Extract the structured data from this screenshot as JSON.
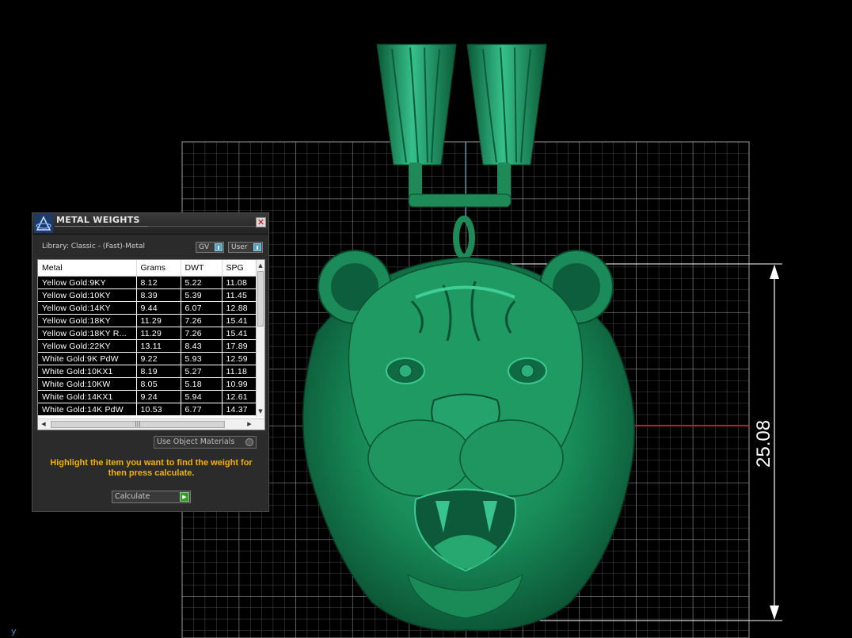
{
  "panel": {
    "title": "METAL WEIGHTS",
    "library_label": "Library: Classic - (Fast)-Metal",
    "toggle_gv": "GV",
    "toggle_user": "User",
    "close_glyph": "✕",
    "columns": [
      "Metal",
      "Grams",
      "DWT",
      "SPG"
    ],
    "rows": [
      [
        "Yellow Gold:9KY",
        "8.12",
        "5.22",
        "11.08"
      ],
      [
        "Yellow Gold:10KY",
        "8.39",
        "5.39",
        "11.45"
      ],
      [
        "Yellow Gold:14KY",
        "9.44",
        "6.07",
        "12.88"
      ],
      [
        "Yellow Gold:18KY",
        "11.29",
        "7.26",
        "15.41"
      ],
      [
        "Yellow Gold:18KY R...",
        "11.29",
        "7.26",
        "15.41"
      ],
      [
        "Yellow Gold:22KY",
        "13.11",
        "8.43",
        "17.89"
      ],
      [
        "White Gold:9K PdW",
        "9.22",
        "5.93",
        "12.59"
      ],
      [
        "White Gold:10KX1",
        "8.19",
        "5.27",
        "11.18"
      ],
      [
        "White Gold:10KW",
        "8.05",
        "5.18",
        "10.99"
      ],
      [
        "White Gold:14KX1",
        "9.24",
        "5.94",
        "12.61"
      ],
      [
        "White Gold:14K PdW",
        "10.53",
        "6.77",
        "14.37"
      ]
    ],
    "use_object_materials": "Use Object Materials",
    "hint": "Highlight the item you want to find the weight for then press calculate.",
    "calculate_label": "Calculate"
  },
  "viewport": {
    "dimension_value": "25.08",
    "axis_label": "y"
  },
  "colors": {
    "background": "#000000",
    "model_green": "#1f8a5a",
    "grid": "#7a7a7a",
    "hint_text": "#f2b100",
    "dimension_red": "#c81e1e"
  }
}
